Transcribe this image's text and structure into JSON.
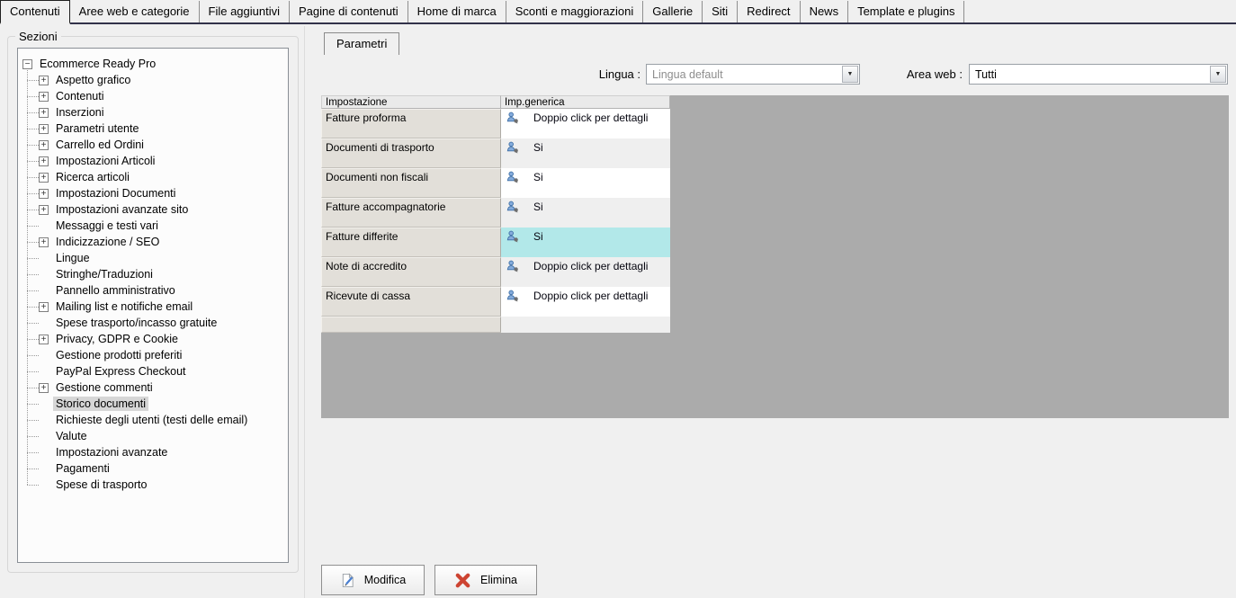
{
  "tabs": {
    "items": [
      "Contenuti",
      "Aree web e categorie",
      "File aggiuntivi",
      "Pagine di contenuti",
      "Home di marca",
      "Sconti e maggiorazioni",
      "Gallerie",
      "Siti",
      "Redirect",
      "News",
      "Template e plugins"
    ],
    "active_index": 0
  },
  "sidebar": {
    "group_label": "Sezioni",
    "tree": {
      "root": {
        "label": "Ecommerce Ready Pro",
        "expander": "minus"
      },
      "items": [
        {
          "label": "Aspetto grafico",
          "expander": "plus"
        },
        {
          "label": "Contenuti",
          "expander": "plus"
        },
        {
          "label": "Inserzioni",
          "expander": "plus"
        },
        {
          "label": "Parametri utente",
          "expander": "plus"
        },
        {
          "label": "Carrello ed Ordini",
          "expander": "plus"
        },
        {
          "label": "Impostazioni Articoli",
          "expander": "plus"
        },
        {
          "label": "Ricerca articoli",
          "expander": "plus"
        },
        {
          "label": "Impostazioni Documenti",
          "expander": "plus"
        },
        {
          "label": "Impostazioni avanzate sito",
          "expander": "plus"
        },
        {
          "label": "Messaggi e testi vari",
          "expander": "none"
        },
        {
          "label": "Indicizzazione / SEO",
          "expander": "plus"
        },
        {
          "label": "Lingue",
          "expander": "none"
        },
        {
          "label": "Stringhe/Traduzioni",
          "expander": "none"
        },
        {
          "label": "Pannello amministrativo",
          "expander": "none"
        },
        {
          "label": "Mailing list e notifiche email",
          "expander": "plus"
        },
        {
          "label": "Spese trasporto/incasso gratuite",
          "expander": "none"
        },
        {
          "label": "Privacy, GDPR e Cookie",
          "expander": "plus"
        },
        {
          "label": "Gestione prodotti preferiti",
          "expander": "none"
        },
        {
          "label": "PayPal Express Checkout",
          "expander": "none"
        },
        {
          "label": "Gestione commenti",
          "expander": "plus"
        },
        {
          "label": "Storico documenti",
          "expander": "none",
          "selected": true
        },
        {
          "label": "Richieste degli utenti (testi delle email)",
          "expander": "none"
        },
        {
          "label": "Valute",
          "expander": "none"
        },
        {
          "label": "Impostazioni avanzate",
          "expander": "none"
        },
        {
          "label": "Pagamenti",
          "expander": "none"
        },
        {
          "label": "Spese di trasporto",
          "expander": "none"
        }
      ]
    }
  },
  "content": {
    "tab_label": "Parametri",
    "filters": {
      "lingua_label": "Lingua :",
      "lingua_value": "Lingua default",
      "area_label": "Area web :",
      "area_value": "Tutti"
    },
    "table": {
      "columns": [
        "Impostazione",
        "Imp.generica"
      ],
      "rows": [
        {
          "setting": "Fatture proforma",
          "value": "Doppio click per dettagli",
          "highlight": false
        },
        {
          "setting": "Documenti di trasporto",
          "value": "Si",
          "highlight": false
        },
        {
          "setting": "Documenti non fiscali",
          "value": "Si",
          "highlight": false
        },
        {
          "setting": "Fatture accompagnatorie",
          "value": "Si",
          "highlight": false
        },
        {
          "setting": "Fatture differite",
          "value": "Si",
          "highlight": true
        },
        {
          "setting": "Note di accredito",
          "value": "Doppio click per dettagli",
          "highlight": false
        },
        {
          "setting": "Ricevute di cassa",
          "value": "Doppio click per dettagli",
          "highlight": false
        }
      ]
    },
    "buttons": {
      "modifica": "Modifica",
      "elimina": "Elimina"
    }
  },
  "icons": {
    "plus": "+",
    "minus": "−",
    "dropdown_arrow": "▼"
  },
  "colors": {
    "highlight_cell": "#b2e8e9",
    "selected_tree_bg": "#d6d6d6",
    "panel_gray": "#ababab",
    "tab_underline": "#32324a"
  }
}
